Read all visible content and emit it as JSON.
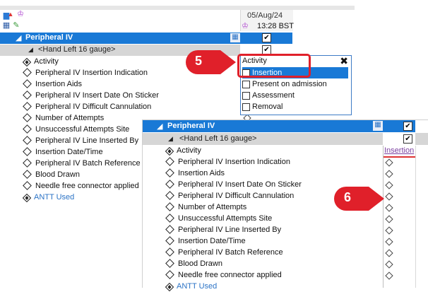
{
  "back_panel": {
    "date": "05/Aug/24",
    "time": "13:28 BST",
    "section_header": "Peripheral IV",
    "group_header": "<Hand Left 16 gauge>",
    "rows": [
      {
        "label": "Activity",
        "icon": "activity-icon"
      },
      {
        "label": "Peripheral IV Insertion Indication"
      },
      {
        "label": "Insertion Aids"
      },
      {
        "label": "Peripheral IV Insert Date On Sticker"
      },
      {
        "label": "Peripheral IV Difficult Cannulation"
      },
      {
        "label": "Number of Attempts"
      },
      {
        "label": "Unsuccessful Attempts Site"
      },
      {
        "label": "Peripheral IV Line Inserted By"
      },
      {
        "label": "Insertion Date/Time"
      },
      {
        "label": "Peripheral IV Batch Reference"
      },
      {
        "label": "Blood Drawn"
      },
      {
        "label": "Needle free connector applied"
      },
      {
        "label": "ANTT Used",
        "link": true
      }
    ]
  },
  "popup": {
    "title": "Activity",
    "close": "✖",
    "options": [
      {
        "label": "Insertion",
        "checked": true,
        "selected": true
      },
      {
        "label": "Present on admission",
        "checked": false
      },
      {
        "label": "Assessment",
        "checked": false
      },
      {
        "label": "Removal",
        "checked": false
      }
    ]
  },
  "callouts": {
    "first": "5",
    "second": "6"
  },
  "front_panel": {
    "section_header": "Peripheral IV",
    "group_header": "<Hand Left 16 gauge>",
    "activity_value": "Insertion",
    "rows": [
      {
        "label": "Activity"
      },
      {
        "label": "Peripheral IV Insertion Indication"
      },
      {
        "label": "Insertion Aids"
      },
      {
        "label": "Peripheral IV Insert Date On Sticker"
      },
      {
        "label": "Peripheral IV Difficult Cannulation"
      },
      {
        "label": "Number of Attempts"
      },
      {
        "label": "Unsuccessful Attempts Site"
      },
      {
        "label": "Peripheral IV Line Inserted By"
      },
      {
        "label": "Insertion Date/Time"
      },
      {
        "label": "Peripheral IV Batch Reference"
      },
      {
        "label": "Blood Drawn"
      },
      {
        "label": "Needle free connector applied"
      },
      {
        "label": "ANTT Used",
        "link": true
      }
    ]
  },
  "colors": {
    "header_blue": "#1979d6",
    "callout_red": "#e0202a",
    "link_blue": "#2b73c6",
    "link_purple": "#7b3fa0"
  }
}
